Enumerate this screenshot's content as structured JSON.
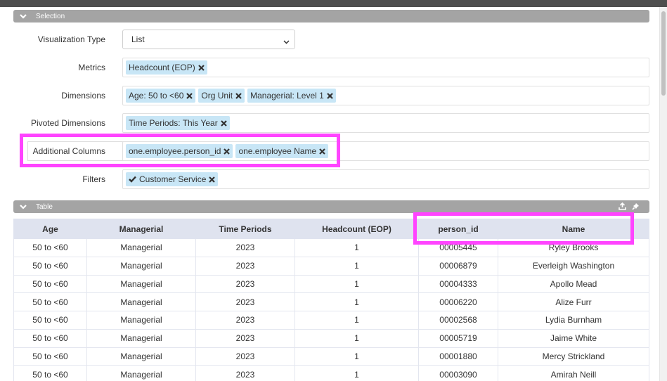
{
  "sections": {
    "selection_title": "Selection",
    "table_title": "Table"
  },
  "fields": {
    "visualization_type": {
      "label": "Visualization Type",
      "value": "List"
    },
    "metrics": {
      "label": "Metrics",
      "tags": [
        "Headcount (EOP)"
      ]
    },
    "dimensions": {
      "label": "Dimensions",
      "tags": [
        "Age: 50 to <60",
        "Org Unit",
        "Managerial: Level 1"
      ]
    },
    "pivoted_dimensions": {
      "label": "Pivoted Dimensions",
      "tags": [
        "Time Periods: This Year"
      ]
    },
    "additional_columns": {
      "label": "Additional Columns",
      "tags": [
        "one.employee.person_id",
        "one.employee Name"
      ]
    },
    "filters": {
      "label": "Filters",
      "tags": [
        "Customer Service"
      ]
    }
  },
  "table": {
    "columns": [
      "Age",
      "Managerial",
      "Time Periods",
      "Headcount (EOP)",
      "person_id",
      "Name"
    ],
    "rows": [
      [
        "50 to <60",
        "Managerial",
        "2023",
        "1",
        "00005445",
        "Ryley Brooks"
      ],
      [
        "50 to <60",
        "Managerial",
        "2023",
        "1",
        "00006879",
        "Everleigh Washington"
      ],
      [
        "50 to <60",
        "Managerial",
        "2023",
        "1",
        "00004333",
        "Apollo Mead"
      ],
      [
        "50 to <60",
        "Managerial",
        "2023",
        "1",
        "00006220",
        "Alize Furr"
      ],
      [
        "50 to <60",
        "Managerial",
        "2023",
        "1",
        "00002568",
        "Lydia Burnham"
      ],
      [
        "50 to <60",
        "Managerial",
        "2023",
        "1",
        "00005719",
        "Jaime White"
      ],
      [
        "50 to <60",
        "Managerial",
        "2023",
        "1",
        "00001880",
        "Mercy Strickland"
      ],
      [
        "50 to <60",
        "Managerial",
        "2023",
        "1",
        "00003090",
        "Amirah Neill"
      ]
    ]
  },
  "icons": {
    "collapse": "chevron-down-icon",
    "remove_tag": "x-icon",
    "filter_active": "check-icon",
    "export": "export-icon",
    "pin": "pin-icon"
  },
  "colors": {
    "tag_bg": "#c8e6f6",
    "section_header_bg": "#a4a4a4",
    "table_header_bg": "#dfe3ef",
    "highlight": "#ff44ff"
  }
}
